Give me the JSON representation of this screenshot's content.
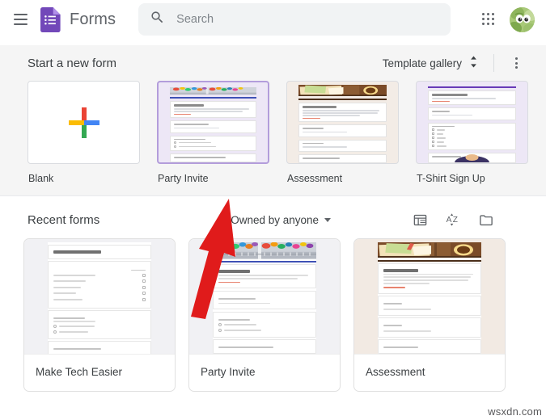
{
  "app": {
    "brand_name": "Forms",
    "accent_purple": "#7248b9",
    "bg_gray": "#f5f5f5"
  },
  "topbar": {
    "menu_icon": "hamburger-menu-icon",
    "logo_icon": "google-forms-logo-icon",
    "search": {
      "icon": "search-icon",
      "placeholder": "Search",
      "value": ""
    },
    "apps_icon": "apps-grid-icon",
    "avatar_icon": "user-avatar"
  },
  "new_form": {
    "title": "Start a new form",
    "template_gallery_label": "Template gallery",
    "expand_icon": "chevron-up-down-icon",
    "more_icon": "more-vertical-icon",
    "templates": [
      {
        "label": "Blank",
        "kind": "blank",
        "selected": false,
        "accent": "#673ab7",
        "bg": "#ffffff"
      },
      {
        "label": "Party Invite",
        "kind": "party",
        "selected": true,
        "accent": "#3f51b5",
        "bg": "#ede7f6"
      },
      {
        "label": "Assessment",
        "kind": "assessment",
        "selected": false,
        "accent": "#5d4037",
        "bg": "#f3ece6"
      },
      {
        "label": "T-Shirt Sign Up",
        "kind": "tshirt",
        "selected": false,
        "accent": "#673ab7",
        "bg": "#ede7f6"
      }
    ]
  },
  "recent": {
    "title": "Recent forms",
    "owner_filter_label": "Owned by anyone",
    "owner_caret_icon": "caret-down-icon",
    "list_view_icon": "list-view-icon",
    "sort_icon": "sort-az-icon",
    "folder_icon": "folder-icon",
    "cards": [
      {
        "title": "Make Tech Easier",
        "kind": "mte",
        "accent": "#673ab7"
      },
      {
        "title": "Party Invite",
        "kind": "party",
        "accent": "#3f51b5"
      },
      {
        "title": "Assessment",
        "kind": "assessment",
        "accent": "#5d4037"
      }
    ]
  },
  "annotation": {
    "arrow_color": "#e01b1b",
    "arrow_name": "red-pointer-arrow"
  },
  "watermark": {
    "text": "wsxdn.com"
  }
}
